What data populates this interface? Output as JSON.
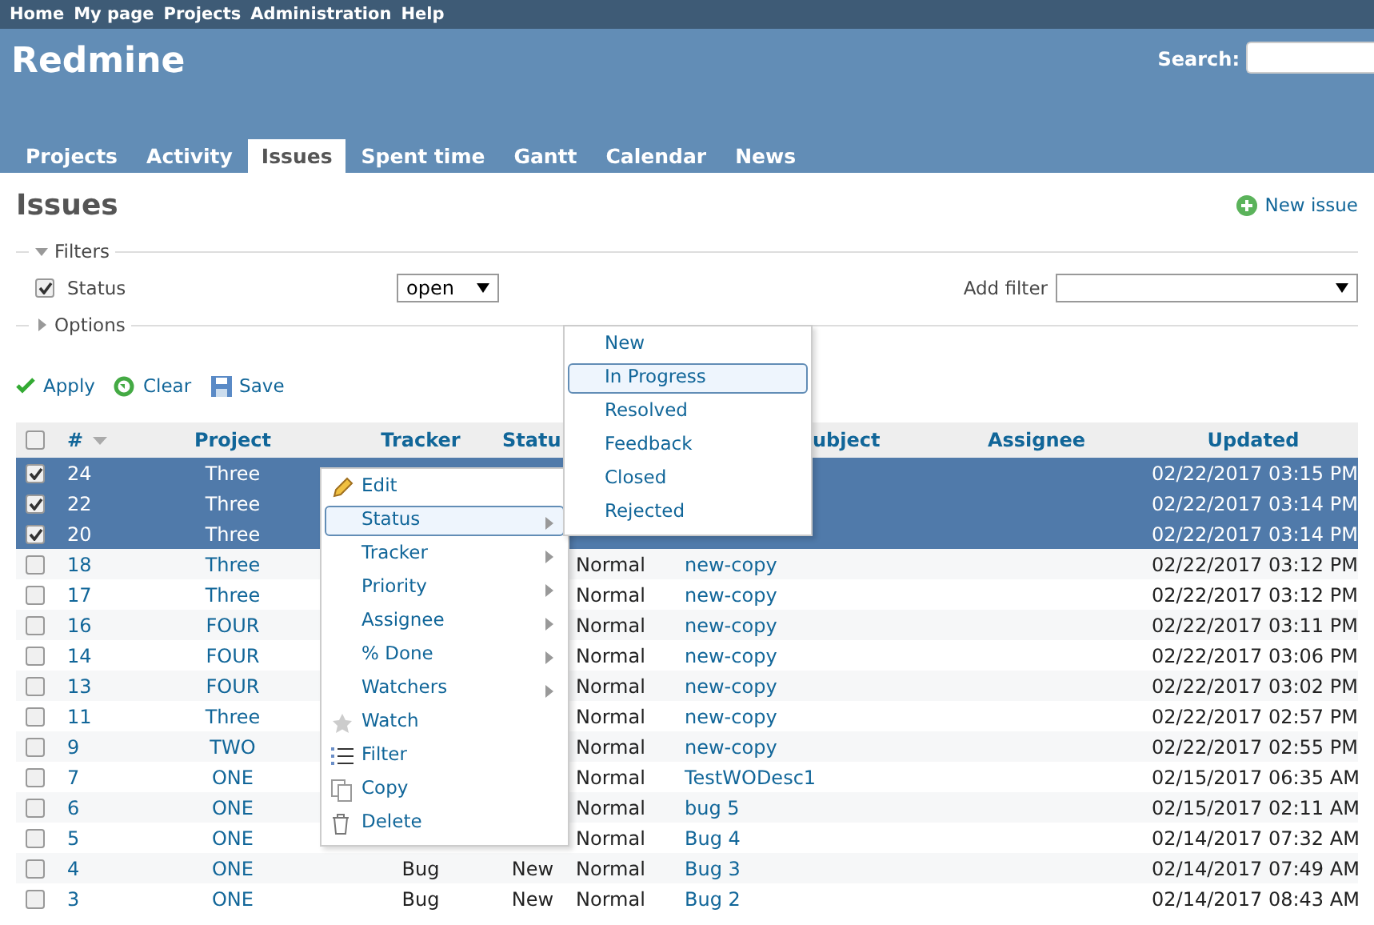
{
  "top_menu": [
    "Home",
    "My page",
    "Projects",
    "Administration",
    "Help"
  ],
  "header": {
    "title": "Redmine",
    "search_label": "Search:"
  },
  "tabs": [
    {
      "label": "Projects",
      "selected": false
    },
    {
      "label": "Activity",
      "selected": false
    },
    {
      "label": "Issues",
      "selected": true
    },
    {
      "label": "Spent time",
      "selected": false
    },
    {
      "label": "Gantt",
      "selected": false
    },
    {
      "label": "Calendar",
      "selected": false
    },
    {
      "label": "News",
      "selected": false
    }
  ],
  "page_title": "Issues",
  "new_issue": "New issue",
  "filters": {
    "legend": "Filters",
    "expanded": true,
    "status_label": "Status",
    "status_checked": true,
    "status_operator": "open",
    "add_filter_label": "Add filter"
  },
  "options": {
    "legend": "Options",
    "expanded": false
  },
  "actions": [
    {
      "label": "Apply",
      "kind": "apply"
    },
    {
      "label": "Clear",
      "kind": "clear"
    },
    {
      "label": "Save",
      "kind": "save"
    }
  ],
  "table": {
    "all_checked": false,
    "headers": {
      "number": "#",
      "project": "Project",
      "tracker": "Tracker",
      "status": "Statu",
      "subject": "ubject",
      "assignee": "Assignee",
      "updated": "Updated"
    },
    "rows": [
      {
        "selected": true,
        "number": "24",
        "project": "Three",
        "updated": "02/22/2017 03:15 PM"
      },
      {
        "selected": true,
        "number": "22",
        "project": "Three",
        "updated": "02/22/2017 03:14 PM"
      },
      {
        "selected": true,
        "number": "20",
        "project": "Three",
        "updated": "02/22/2017 03:14 PM"
      },
      {
        "selected": false,
        "number": "18",
        "project": "Three",
        "priority": "Normal",
        "subject": "new-copy",
        "updated": "02/22/2017 03:12 PM"
      },
      {
        "selected": false,
        "number": "17",
        "project": "Three",
        "priority": "Normal",
        "subject": "new-copy",
        "updated": "02/22/2017 03:12 PM"
      },
      {
        "selected": false,
        "number": "16",
        "project": "FOUR",
        "priority": "Normal",
        "subject": "new-copy",
        "updated": "02/22/2017 03:11 PM"
      },
      {
        "selected": false,
        "number": "14",
        "project": "FOUR",
        "priority": "Normal",
        "subject": "new-copy",
        "updated": "02/22/2017 03:06 PM"
      },
      {
        "selected": false,
        "number": "13",
        "project": "FOUR",
        "priority": "Normal",
        "subject": "new-copy",
        "updated": "02/22/2017 03:02 PM"
      },
      {
        "selected": false,
        "number": "11",
        "project": "Three",
        "priority": "Normal",
        "subject": "new-copy",
        "updated": "02/22/2017 02:57 PM"
      },
      {
        "selected": false,
        "number": "9",
        "project": "TWO",
        "priority": "Normal",
        "subject": "new-copy",
        "updated": "02/22/2017 02:55 PM"
      },
      {
        "selected": false,
        "number": "7",
        "project": "ONE",
        "priority": "Normal",
        "subject": "TestWODesc1",
        "updated": "02/15/2017 06:35 AM"
      },
      {
        "selected": false,
        "number": "6",
        "project": "ONE",
        "priority": "Normal",
        "subject": "bug 5",
        "updated": "02/15/2017 02:11 AM"
      },
      {
        "selected": false,
        "number": "5",
        "project": "ONE",
        "priority": "Normal",
        "subject": "Bug 4",
        "updated": "02/14/2017 07:32 AM"
      },
      {
        "selected": false,
        "number": "4",
        "project": "ONE",
        "tracker": "Bug",
        "status": "New",
        "priority": "Normal",
        "subject": "Bug 3",
        "updated": "02/14/2017 07:49 AM"
      },
      {
        "selected": false,
        "number": "3",
        "project": "ONE",
        "tracker": "Bug",
        "status": "New",
        "priority": "Normal",
        "subject": "Bug 2",
        "updated": "02/14/2017 08:43 AM"
      }
    ]
  },
  "context_menu": {
    "items": [
      {
        "label": "Edit",
        "kind": "edit",
        "selected": false
      },
      {
        "label": "Status",
        "kind": "submenu",
        "selected": true
      },
      {
        "label": "Tracker",
        "kind": "submenu",
        "selected": false
      },
      {
        "label": "Priority",
        "kind": "submenu",
        "selected": false
      },
      {
        "label": "Assignee",
        "kind": "submenu",
        "selected": false
      },
      {
        "label": "% Done",
        "kind": "submenu",
        "selected": false
      },
      {
        "label": "Watchers",
        "kind": "submenu",
        "selected": false
      },
      {
        "label": "Watch",
        "kind": "watch",
        "selected": false
      },
      {
        "label": "Filter",
        "kind": "filter",
        "selected": false
      },
      {
        "label": "Copy",
        "kind": "copy",
        "selected": false
      },
      {
        "label": "Delete",
        "kind": "delete",
        "selected": false
      }
    ]
  },
  "status_submenu": {
    "items": [
      {
        "label": "New",
        "selected": false
      },
      {
        "label": "In Progress",
        "selected": true
      },
      {
        "label": "Resolved",
        "selected": false
      },
      {
        "label": "Feedback",
        "selected": false
      },
      {
        "label": "Closed",
        "selected": false
      },
      {
        "label": "Rejected",
        "selected": false
      }
    ]
  }
}
